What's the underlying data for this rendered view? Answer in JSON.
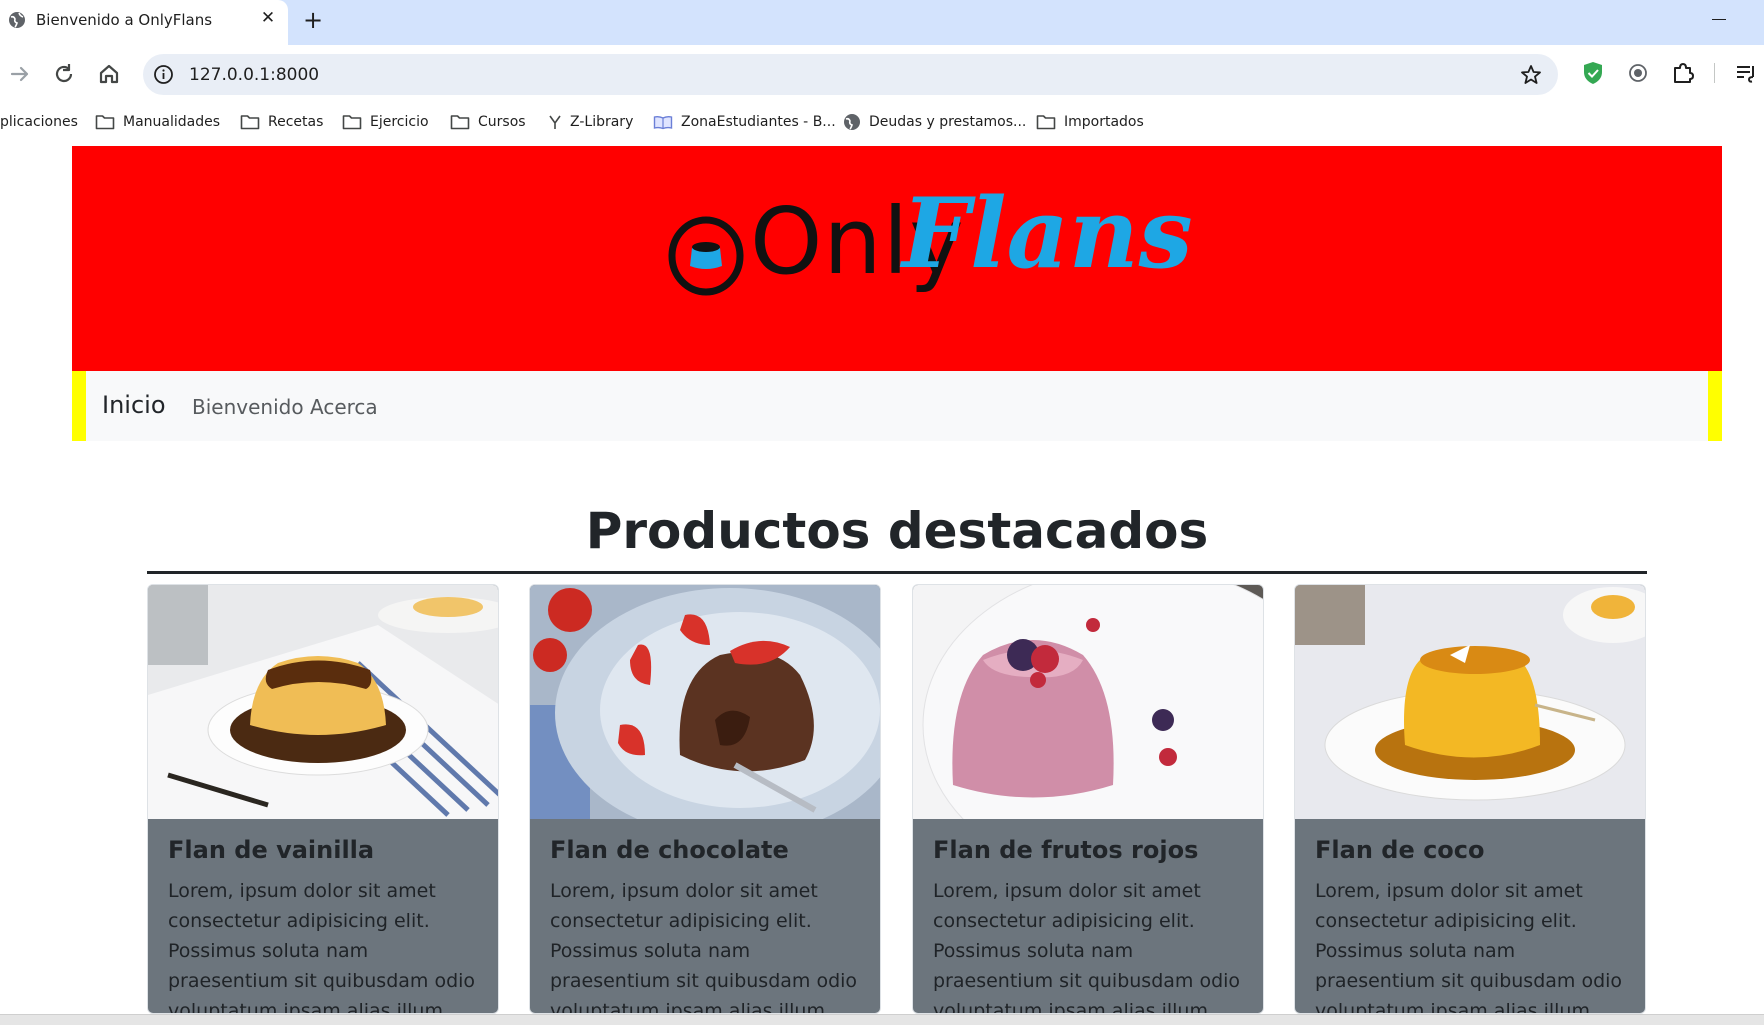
{
  "browser": {
    "tab_title": "Bienvenido a OnlyFlans",
    "new_tab": "+",
    "close": "✕",
    "url": "127.0.0.1:8000"
  },
  "bookmarks": [
    "plicaciones",
    "Manualidades",
    "Recetas",
    "Ejercicio",
    "Cursos",
    "Z-Library",
    "ZonaEstudiantes - B...",
    "Deudas y prestamos...",
    "Importados"
  ],
  "logo": {
    "text_plain": "Only",
    "text_script": "Flans"
  },
  "navbar": {
    "brand": "Inicio",
    "links": [
      "Bienvenido",
      "Acerca"
    ]
  },
  "section": {
    "title": "Productos destacados"
  },
  "cards": [
    {
      "title": "Flan de vainilla",
      "text": "Lorem, ipsum dolor sit amet consectetur adipisicing elit. Possimus soluta nam praesentium sit quibusdam odio voluptatum ipsam alias illum atque aperiam"
    },
    {
      "title": "Flan de chocolate",
      "text": "Lorem, ipsum dolor sit amet consectetur adipisicing elit. Possimus soluta nam praesentium sit quibusdam odio voluptatum ipsam alias illum atque aperiam"
    },
    {
      "title": "Flan de frutos rojos",
      "text": "Lorem, ipsum dolor sit amet consectetur adipisicing elit. Possimus soluta nam praesentium sit quibusdam odio voluptatum ipsam alias illum atque aperiam"
    },
    {
      "title": "Flan de coco",
      "text": "Lorem, ipsum dolor sit amet consectetur adipisicing elit. Possimus soluta nam praesentium sit quibusdam odio voluptatum ipsam alias illum atque aperiam"
    }
  ],
  "colors": {
    "hero": "#ff0000",
    "nav_accent": "#ffff00",
    "card_bg": "#6c757d",
    "logo_script": "#1ea7e4"
  }
}
